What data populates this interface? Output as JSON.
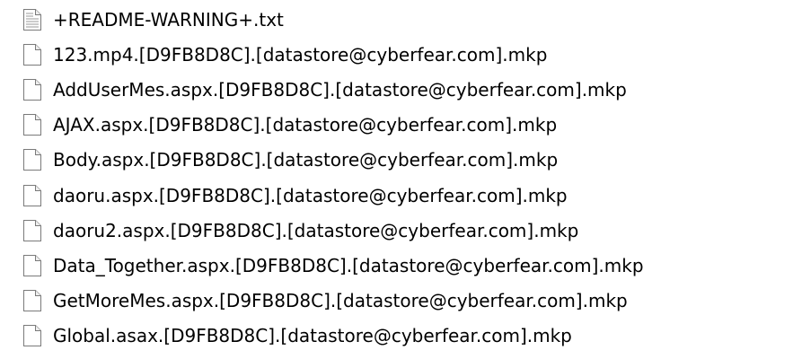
{
  "files": [
    {
      "name": "+README-WARNING+.txt",
      "icon": "text-file-icon"
    },
    {
      "name": "123.mp4.[D9FB8D8C].[datastore@cyberfear.com].mkp",
      "icon": "blank-file-icon"
    },
    {
      "name": "AddUserMes.aspx.[D9FB8D8C].[datastore@cyberfear.com].mkp",
      "icon": "blank-file-icon"
    },
    {
      "name": "AJAX.aspx.[D9FB8D8C].[datastore@cyberfear.com].mkp",
      "icon": "blank-file-icon"
    },
    {
      "name": "Body.aspx.[D9FB8D8C].[datastore@cyberfear.com].mkp",
      "icon": "blank-file-icon"
    },
    {
      "name": "daoru.aspx.[D9FB8D8C].[datastore@cyberfear.com].mkp",
      "icon": "blank-file-icon"
    },
    {
      "name": "daoru2.aspx.[D9FB8D8C].[datastore@cyberfear.com].mkp",
      "icon": "blank-file-icon"
    },
    {
      "name": "Data_Together.aspx.[D9FB8D8C].[datastore@cyberfear.com].mkp",
      "icon": "blank-file-icon"
    },
    {
      "name": "GetMoreMes.aspx.[D9FB8D8C].[datastore@cyberfear.com].mkp",
      "icon": "blank-file-icon"
    },
    {
      "name": "Global.asax.[D9FB8D8C].[datastore@cyberfear.com].mkp",
      "icon": "blank-file-icon"
    }
  ]
}
